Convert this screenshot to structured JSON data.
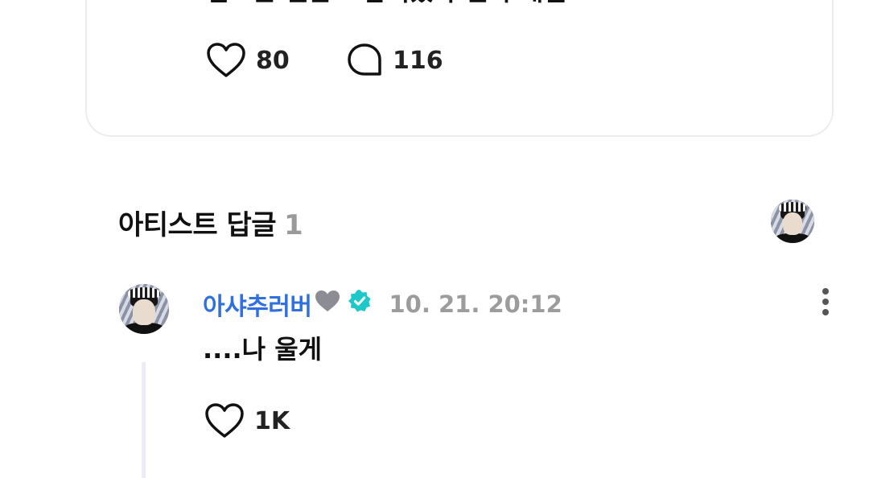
{
  "post": {
    "text": "김도훈 팬한 보람이있다 진짜 매일",
    "like_count": "80",
    "comment_count": "116"
  },
  "artist_replies": {
    "title": "아티스트 답글",
    "count": "1"
  },
  "comment": {
    "author": "아샤추러버",
    "time": "10. 21. 20:12",
    "text": "....나 울게",
    "like_count": "1K"
  },
  "colors": {
    "author": "#2f6fe0",
    "verified": "#1ec8c8",
    "muted": "#9c9c9c"
  },
  "icons": {
    "like": "heart-outline-icon",
    "comment": "speech-bubble-icon",
    "verified": "verified-badge-icon",
    "more": "more-vertical-icon"
  }
}
